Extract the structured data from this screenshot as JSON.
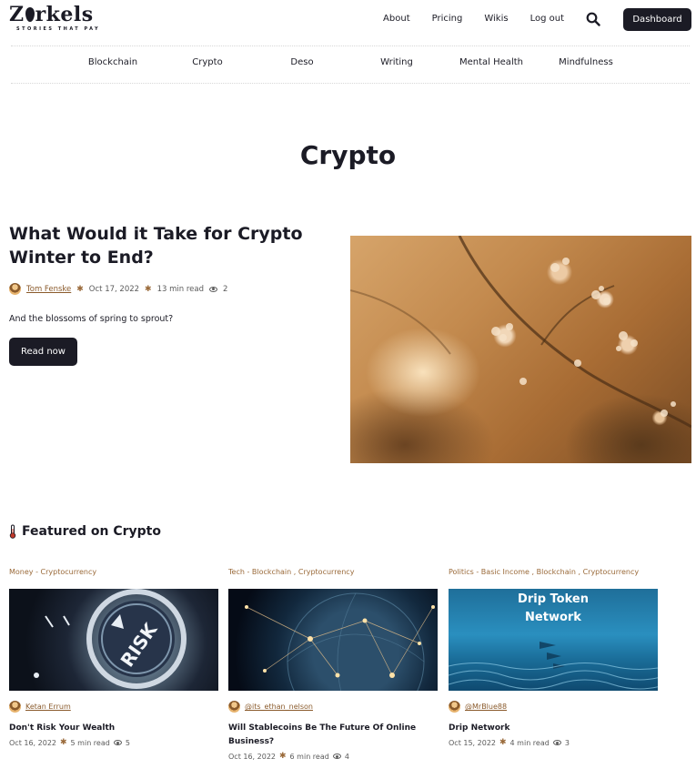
{
  "brand": {
    "name_start": "Z",
    "name_end": "rkels",
    "tagline": "STORIES THAT PAY"
  },
  "nav": {
    "links": [
      "About",
      "Pricing",
      "Wikis",
      "Log out"
    ],
    "search_icon": "search-icon",
    "dashboard_label": "Dashboard"
  },
  "categories": [
    "Blockchain",
    "Crypto",
    "Deso",
    "Writing",
    "Mental Health",
    "Mindfulness"
  ],
  "page_title": "Crypto",
  "hero": {
    "title": "What Would it Take for Crypto Winter to End?",
    "author": "Tom Fenske",
    "date": "Oct 17, 2022",
    "read_time": "13 min read",
    "views": "2",
    "subtitle": "And the blossoms of spring to sprout?",
    "button": "Read now"
  },
  "featured": {
    "heading": "Featured on Crypto",
    "cards": [
      {
        "tags": [
          "Money",
          "Cryptocurrency"
        ],
        "image_icon": "risk-dial-icon",
        "image_text": "RISK",
        "author": "Ketan Errum",
        "title": "Don't Risk Your Wealth",
        "date": "Oct 16, 2022",
        "read_time": "5 min read",
        "views": "5"
      },
      {
        "tags": [
          "Tech",
          "Blockchain",
          "Cryptocurrency"
        ],
        "image_icon": "globe-network-icon",
        "author": "@its_ethan_nelson",
        "title": "Will Stablecoins Be The Future Of Online Business?",
        "date": "Oct 16, 2022",
        "read_time": "6 min read",
        "views": "4"
      },
      {
        "tags": [
          "Politics",
          "Basic Income",
          "Blockchain",
          "Cryptocurrency"
        ],
        "image_icon": "ocean-fish-icon",
        "image_text": "Drip Token Network",
        "author": "@MrBlue88",
        "title": "Drip Network",
        "date": "Oct 15, 2022",
        "read_time": "4 min read",
        "views": "3"
      }
    ]
  },
  "colors": {
    "dark": "#1b1b25",
    "accent": "#9a6a3a"
  }
}
